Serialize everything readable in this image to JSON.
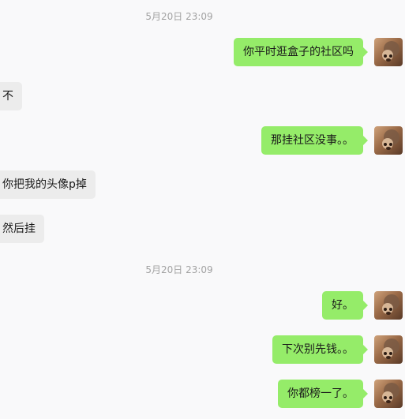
{
  "messages": [
    {
      "kind": "timestamp",
      "text": "5月20日 23:09"
    },
    {
      "kind": "outgoing",
      "text": "你平时逛盒子的社区吗"
    },
    {
      "kind": "incoming",
      "text": "不"
    },
    {
      "kind": "outgoing",
      "text": "那挂社区没事。。"
    },
    {
      "kind": "incoming",
      "text": "你把我的头像p掉"
    },
    {
      "kind": "incoming",
      "text": "然后挂"
    },
    {
      "kind": "timestamp",
      "text": "5月20日 23:09"
    },
    {
      "kind": "outgoing",
      "text": "好。"
    },
    {
      "kind": "outgoing",
      "text": "下次别先钱。。"
    },
    {
      "kind": "outgoing",
      "text": "你都榜一了。"
    }
  ],
  "colors": {
    "background": "#f9f9fa",
    "outgoing_bubble": "#95ec69",
    "incoming_bubble": "#ececec",
    "timestamp_text": "#a3a3a3"
  },
  "icons": {
    "self_avatar": "dog-photo-avatar"
  }
}
